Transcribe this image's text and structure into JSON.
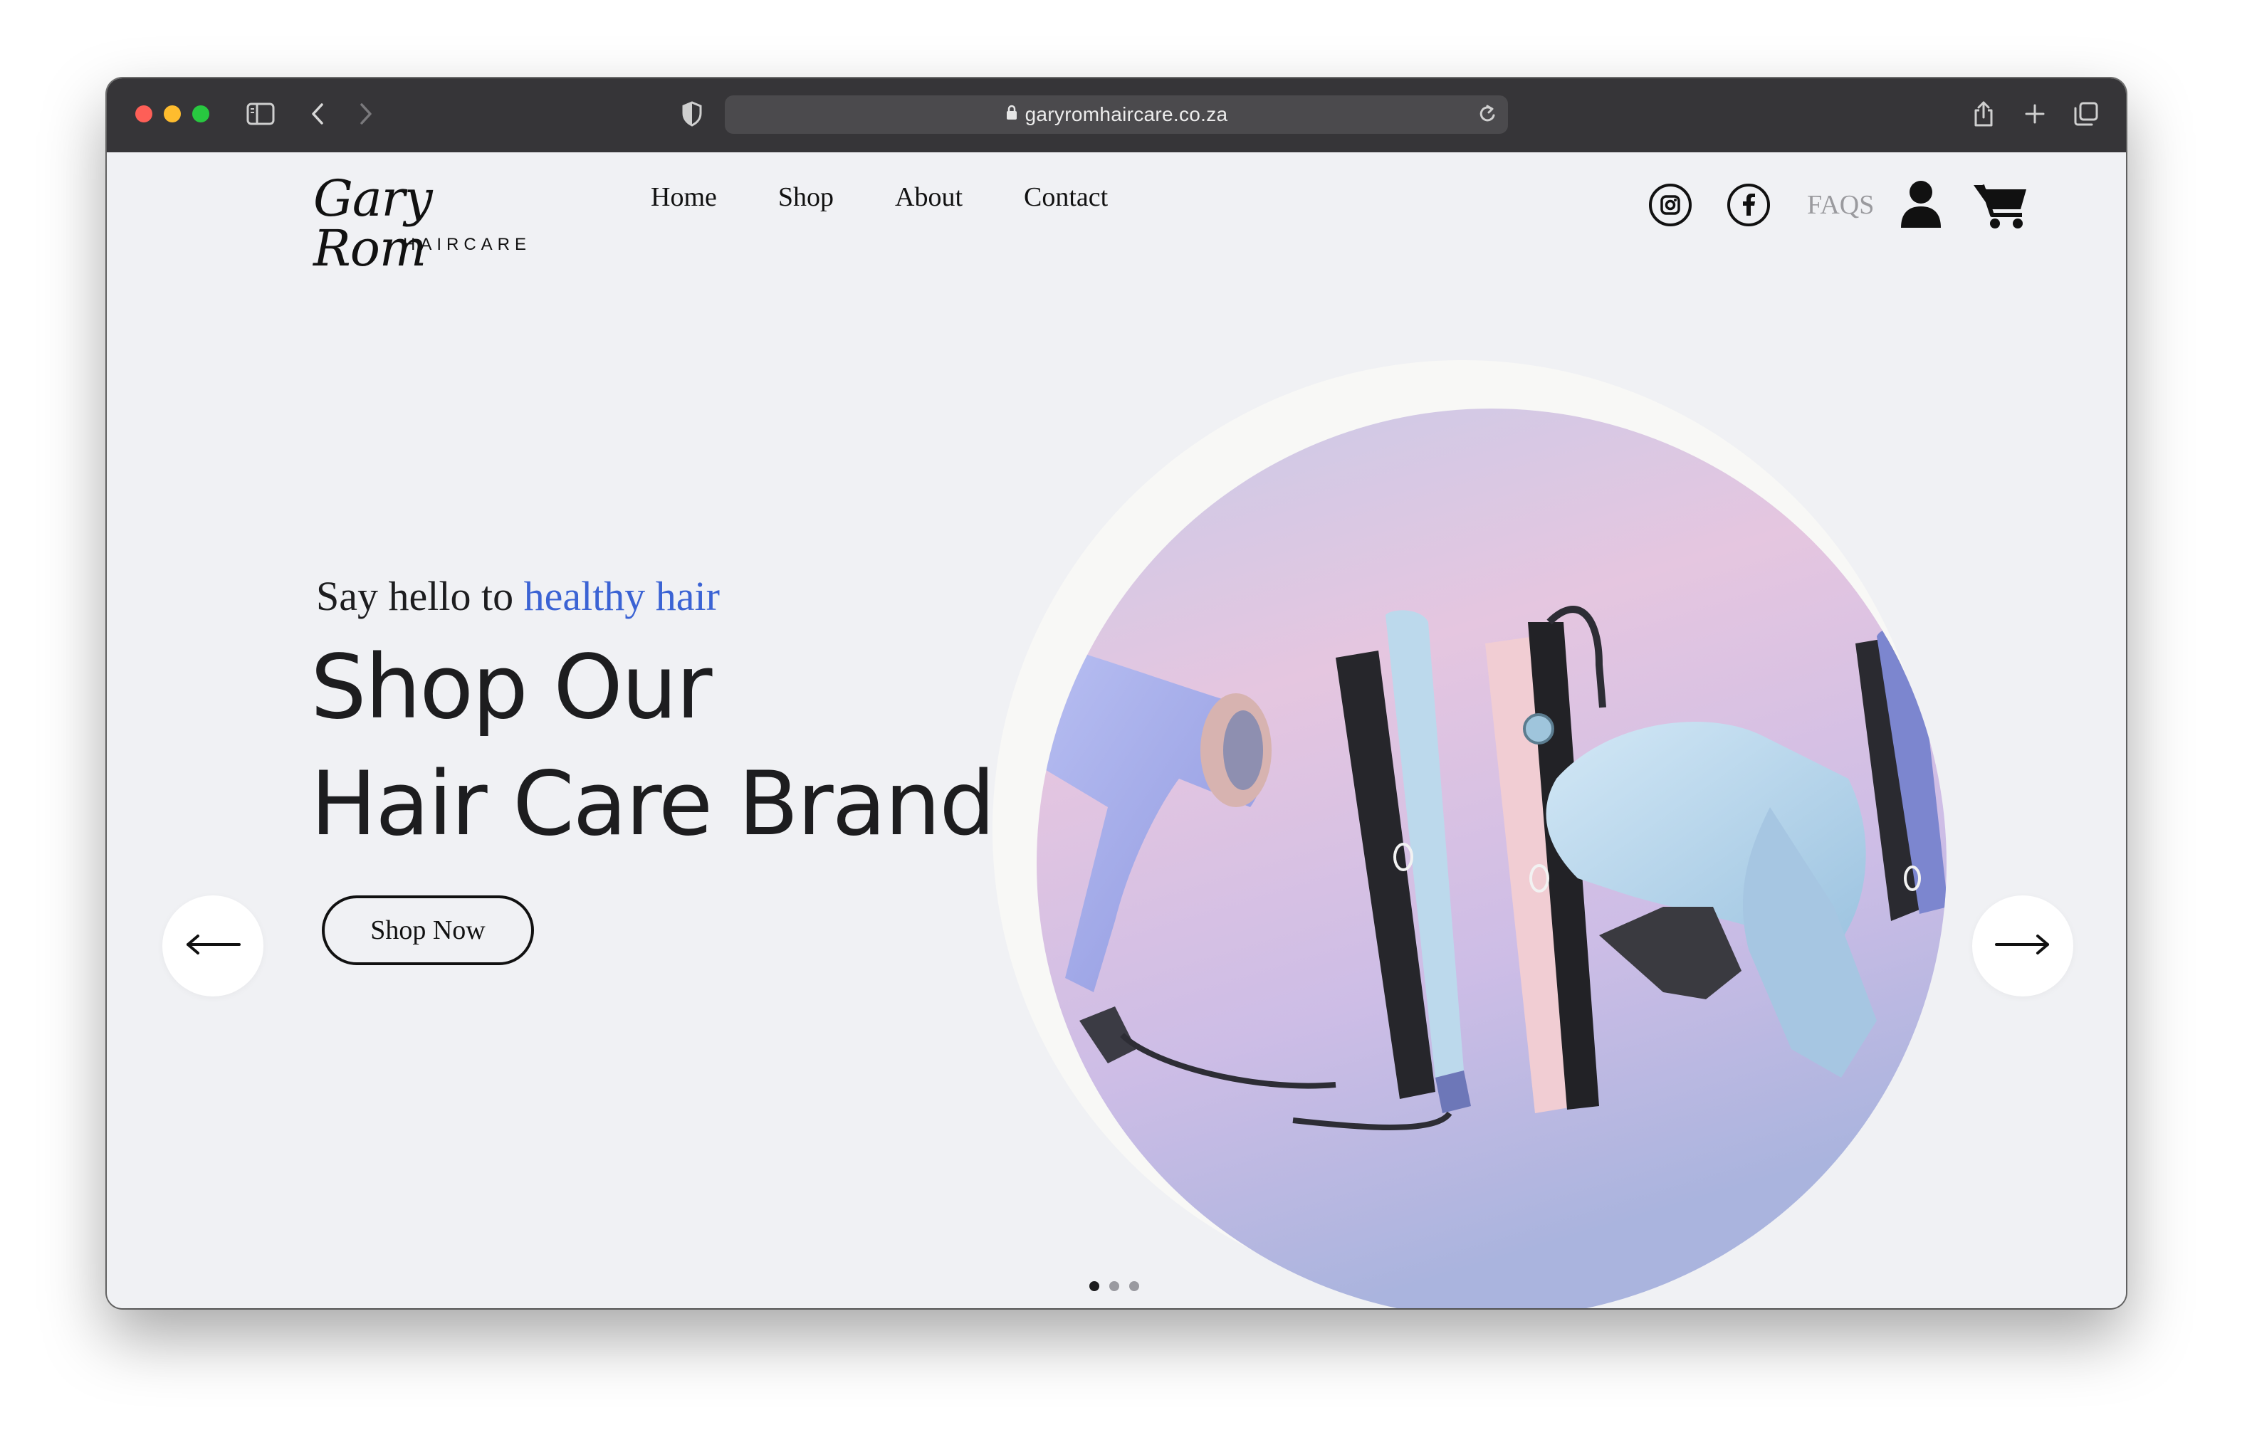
{
  "browser": {
    "url": "garyromhaircare.co.za",
    "icons": [
      "sidebar-icon",
      "back-icon",
      "forward-icon",
      "shield-icon",
      "lock-icon",
      "reload-icon",
      "share-icon",
      "new-tab-icon",
      "tabs-overview-icon"
    ]
  },
  "header": {
    "logo_script": "Gary Rom",
    "logo_sub": "HAIRCARE",
    "nav": [
      "Home",
      "Shop",
      "About",
      "Contact"
    ],
    "faqs_label": "FAQS",
    "icons": [
      "instagram-icon",
      "facebook-icon",
      "user-icon",
      "cart-icon"
    ]
  },
  "hero": {
    "tagline_prefix": "Say hello to ",
    "tagline_accent": "healthy hair",
    "headline_line1": "Shop Our",
    "headline_line2": "Hair Care Brand",
    "cta_label": "Shop Now",
    "slide_count": 3,
    "active_slide": 1
  },
  "colors": {
    "accent": "#3b63d4",
    "page_bg": "#f0f1f4",
    "chrome_bg": "#363538",
    "text": "#1d1d1f",
    "muted": "#9a9a9e"
  }
}
